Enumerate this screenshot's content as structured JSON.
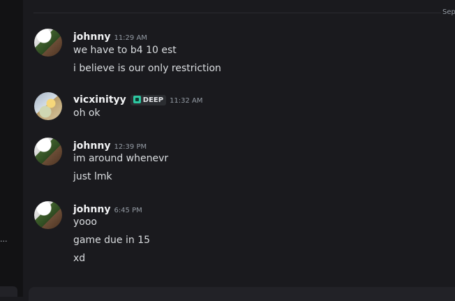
{
  "sidebar": {
    "ellipsis": "..."
  },
  "chat": {
    "divider_label": "Sep",
    "messages": [
      {
        "user": "johnny",
        "time": "11:29 AM",
        "lines": [
          "we have to b4 10 est",
          "i believe is our only restriction"
        ]
      },
      {
        "user": "vicxinityy",
        "badge": "DEEP",
        "time": "11:32 AM",
        "lines": [
          "oh ok"
        ]
      },
      {
        "user": "johnny",
        "time": "12:39 PM",
        "lines": [
          "im around whenevr",
          "just lmk"
        ]
      },
      {
        "user": "johnny",
        "time": "6:45 PM",
        "lines": [
          "yooo",
          "game due in 15",
          "xd"
        ]
      }
    ]
  },
  "colors": {
    "badge_icon": "#2dc7a1",
    "background": "#1a1a1e",
    "username": "#f2f3f5",
    "timestamp": "#949ba4"
  }
}
